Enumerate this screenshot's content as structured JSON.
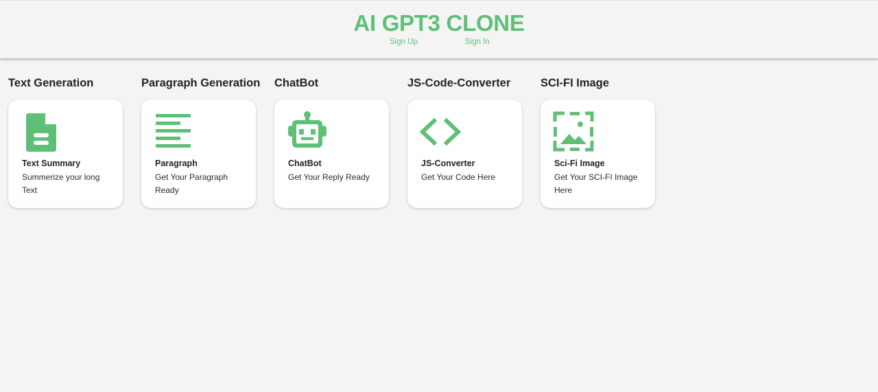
{
  "header": {
    "brand": "AI GPT3 CLONE",
    "sign_up": "Sign Up",
    "sign_in": "Sign In"
  },
  "accent_color": "#5fbf76",
  "tools": [
    {
      "heading": "Text Generation",
      "card_title": "Text Summary",
      "card_desc": "Summerize your long Text",
      "icon": "document-icon"
    },
    {
      "heading": "Paragraph Generation",
      "card_title": "Paragraph",
      "card_desc": "Get Your Paragraph Ready",
      "icon": "align-left-icon"
    },
    {
      "heading": "ChatBot",
      "card_title": "ChatBot",
      "card_desc": "Get Your Reply Ready",
      "icon": "robot-icon"
    },
    {
      "heading": "JS-Code-Converter",
      "card_title": "JS-Converter",
      "card_desc": "Get Your Code Here",
      "icon": "code-icon"
    },
    {
      "heading": "SCI-FI Image",
      "card_title": "Sci-Fi Image",
      "card_desc": "Get Your SCI-FI Image Here",
      "icon": "image-icon"
    }
  ]
}
